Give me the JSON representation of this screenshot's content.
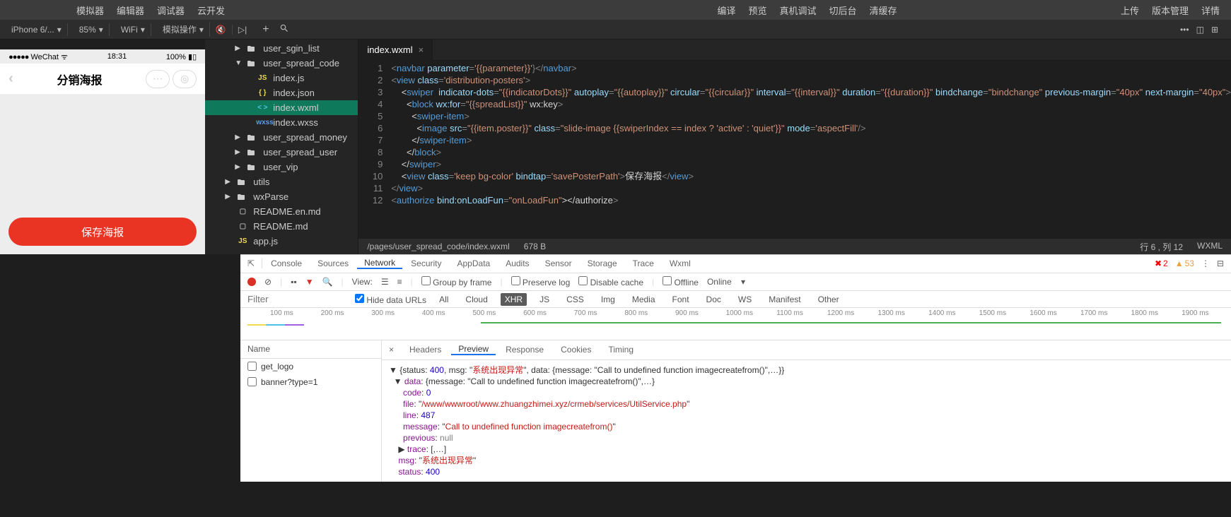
{
  "topbar": {
    "left": [
      "模拟器",
      "编辑器",
      "调试器",
      "云开发"
    ],
    "center": [
      "编译",
      "预览",
      "真机调试",
      "切后台",
      "清缓存"
    ],
    "right": [
      "上传",
      "版本管理",
      "详情"
    ]
  },
  "toolbar": {
    "device": "iPhone 6/...",
    "zoom": "85%",
    "network": "WiFi",
    "action": "模拟操作"
  },
  "phone": {
    "carrier": "WeChat",
    "time": "18:31",
    "battery": "100%",
    "title": "分销海报",
    "saveBtn": "保存海报"
  },
  "fileTree": [
    {
      "indent": 2,
      "arrow": "▶",
      "icon": "folder",
      "name": "user_sgin_list",
      "iconcls": "folder-icon"
    },
    {
      "indent": 2,
      "arrow": "▼",
      "icon": "folder",
      "name": "user_spread_code",
      "iconcls": "folder-icon"
    },
    {
      "indent": 3,
      "arrow": "",
      "icon": "JS",
      "name": "index.js",
      "iconcls": "js-icon"
    },
    {
      "indent": 3,
      "arrow": "",
      "icon": "{ }",
      "name": "index.json",
      "iconcls": "json-icon"
    },
    {
      "indent": 3,
      "arrow": "",
      "icon": "< >",
      "name": "index.wxml",
      "iconcls": "wxml-icon",
      "active": true
    },
    {
      "indent": 3,
      "arrow": "",
      "icon": "wxss",
      "name": "index.wxss",
      "iconcls": "wxss-icon"
    },
    {
      "indent": 2,
      "arrow": "▶",
      "icon": "folder",
      "name": "user_spread_money",
      "iconcls": "folder-icon"
    },
    {
      "indent": 2,
      "arrow": "▶",
      "icon": "folder",
      "name": "user_spread_user",
      "iconcls": "folder-icon"
    },
    {
      "indent": 2,
      "arrow": "▶",
      "icon": "folder",
      "name": "user_vip",
      "iconcls": "folder-icon"
    },
    {
      "indent": 1,
      "arrow": "▶",
      "icon": "folder",
      "name": "utils",
      "iconcls": "folder-icon"
    },
    {
      "indent": 1,
      "arrow": "▶",
      "icon": "folder",
      "name": "wxParse",
      "iconcls": "folder-icon"
    },
    {
      "indent": 1,
      "arrow": "",
      "icon": "▢",
      "name": "README.en.md",
      "iconcls": "md-icon"
    },
    {
      "indent": 1,
      "arrow": "",
      "icon": "▢",
      "name": "README.md",
      "iconcls": "md-icon"
    },
    {
      "indent": 1,
      "arrow": "",
      "icon": "JS",
      "name": "app.js",
      "iconcls": "js-icon"
    }
  ],
  "editor": {
    "tab": "index.wxml",
    "path": "/pages/user_spread_code/index.wxml",
    "size": "678 B",
    "cursor": "行 6 , 列 12",
    "lang": "WXML",
    "lines": 12
  },
  "code": {
    "l1": [
      "<",
      "navbar",
      " parameter",
      "=",
      "'{{parameter}}'",
      "}",
      "</",
      "navbar",
      ">"
    ],
    "l2": [
      "<",
      "view",
      " class",
      "=",
      "'distribution-posters'",
      ">"
    ],
    "l3": [
      "    <",
      "swiper",
      "  indicator-dots",
      "=",
      "\"{{indicatorDots}}\"",
      " autoplay",
      "=",
      "\"{{autoplay}}\"",
      " circular",
      "=",
      "\"{{circular}}\"",
      " interval",
      "=",
      "\"{{interval}}\"",
      " duration",
      "=",
      "\"{{duration}}\"",
      " bindchange",
      "=",
      "\"bindchange\"",
      " previous-margin",
      "=",
      "\"40px\"",
      " next-margin",
      "=",
      "\"40px\"",
      ">"
    ],
    "l4": [
      "      <",
      "block",
      " wx:for",
      "=",
      "\"{{spreadList}}\"",
      " wx:key",
      ">"
    ],
    "l5": [
      "        <",
      "swiper-item",
      ">"
    ],
    "l6": [
      "          <",
      "image",
      " src",
      "=",
      "\"{{item.poster}}\"",
      " class",
      "=",
      "\"slide-image {{swiperIndex == index ? 'active' : 'quiet'}}\"",
      " mode",
      "=",
      "'aspectFill'",
      "/>"
    ],
    "l7": [
      "        </",
      "swiper-item",
      ">"
    ],
    "l8": [
      "      </",
      "block",
      ">"
    ],
    "l9": [
      "    </",
      "swiper",
      ">"
    ],
    "l10": [
      "    <",
      "view",
      " class",
      "=",
      "'keep bg-color'",
      " bindtap",
      "=",
      "'savePosterPath'",
      ">",
      "保存海报",
      "</",
      "view",
      ">"
    ],
    "l11": [
      "</",
      "view",
      ">"
    ],
    "l12": [
      "<",
      "authorize",
      " bind:onLoadFun",
      "=",
      "\"onLoadFun\"",
      "></",
      "authorize",
      ">"
    ]
  },
  "devtools": {
    "tabs": [
      "Console",
      "Sources",
      "Network",
      "Security",
      "AppData",
      "Audits",
      "Sensor",
      "Storage",
      "Trace",
      "Wxml"
    ],
    "activeTab": "Network",
    "errors": "2",
    "warnings": "53",
    "toolbar": {
      "view": "View:",
      "groupByFrame": "Group by frame",
      "preserveLog": "Preserve log",
      "disableCache": "Disable cache",
      "offline": "Offline",
      "online": "Online"
    },
    "filter": {
      "placeholder": "Filter",
      "hideData": "Hide data URLs",
      "types": [
        "All",
        "Cloud",
        "XHR",
        "JS",
        "CSS",
        "Img",
        "Media",
        "Font",
        "Doc",
        "WS",
        "Manifest",
        "Other"
      ],
      "activeType": "XHR"
    },
    "timeline": [
      "100 ms",
      "200 ms",
      "300 ms",
      "400 ms",
      "500 ms",
      "600 ms",
      "700 ms",
      "800 ms",
      "900 ms",
      "1000 ms",
      "1100 ms",
      "1200 ms",
      "1300 ms",
      "1400 ms",
      "1500 ms",
      "1600 ms",
      "1700 ms",
      "1800 ms",
      "1900 ms"
    ],
    "requestsHeader": "Name",
    "requests": [
      "get_logo",
      "banner?type=1"
    ],
    "detailTabs": [
      "Headers",
      "Preview",
      "Response",
      "Cookies",
      "Timing"
    ],
    "activeDetailTab": "Preview",
    "preview": {
      "status": "400",
      "msg": "系统出现异常",
      "dataMessage": "Call to undefined function imagecreatefrom()",
      "code": "0",
      "file": "/www/wwwroot/www.zhuangzhimei.xyz/crmeb/services/UtilService.php",
      "line": "487",
      "message2": "Call to undefined function imagecreatefrom()",
      "previous": "null",
      "trace": "[,…]"
    }
  }
}
